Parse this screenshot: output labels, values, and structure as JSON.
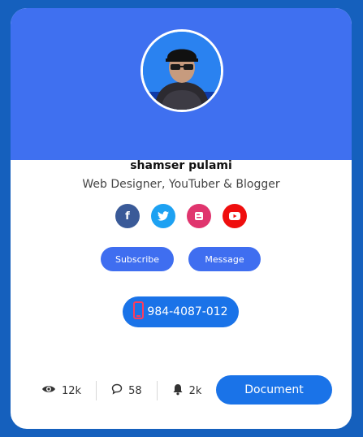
{
  "profile": {
    "name": "shamser pulami",
    "role": "Web Designer, YouTuber & Blogger"
  },
  "socials": [
    {
      "icon": "facebook-icon",
      "glyph": "f",
      "color": "#3a5a98"
    },
    {
      "icon": "twitter-icon",
      "glyph": "",
      "color": "#1da1f2"
    },
    {
      "icon": "blogger-icon",
      "glyph": "B",
      "color": "#e0356e"
    },
    {
      "icon": "youtube-icon",
      "glyph": "",
      "color": "#ef0e0e"
    }
  ],
  "buttons": {
    "subscribe": "Subscribe",
    "message": "Message",
    "document": "Document"
  },
  "phone": {
    "icon": "mobile-phone-icon",
    "number": "984-4087-012"
  },
  "stats": {
    "views": "12k",
    "comments": "58",
    "notifications": "2k"
  },
  "colors": {
    "page_background": "#1560bd",
    "banner": "#3f70f0",
    "accent": "#1a73e8"
  }
}
